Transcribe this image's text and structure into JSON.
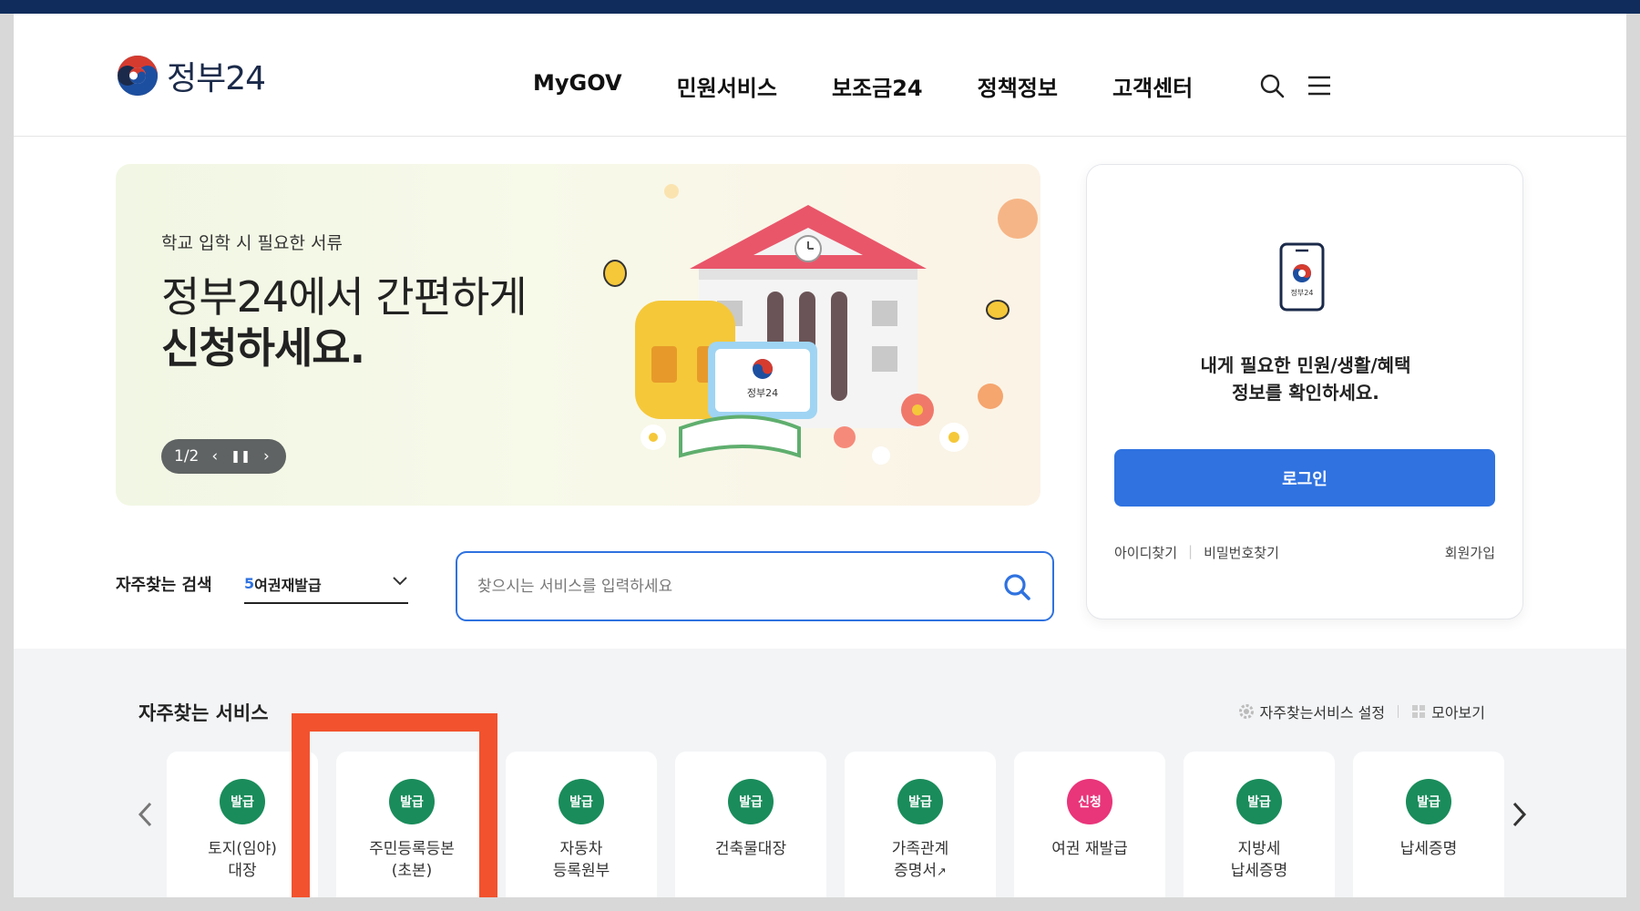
{
  "header": {
    "logo_text": "정부24",
    "nav": [
      "MyGOV",
      "민원서비스",
      "보조금24",
      "정책정보",
      "고객센터"
    ]
  },
  "banner": {
    "subtitle": "학교 입학 시 필요한 서류",
    "title_line1": "정부24에서 간편하게",
    "title_line2": "신청하세요.",
    "pager": "1/2",
    "art_label": "정부24"
  },
  "login": {
    "app_label": "정부24",
    "message_line1": "내게 필요한 민원/생활/혜택",
    "message_line2": "정보를 확인하세요.",
    "button": "로그인",
    "find_id": "아이디찾기",
    "find_pw": "비밀번호찾기",
    "join": "회원가입"
  },
  "search": {
    "freq_label": "자주찾는 검색",
    "rank": "5",
    "keyword": "여권재발급",
    "placeholder": "찾으시는 서비스를 입력하세요"
  },
  "services": {
    "title": "자주찾는 서비스",
    "settings": "자주찾는서비스 설정",
    "view_all": "모아보기",
    "items": [
      {
        "badge": "발급",
        "name1": "토지(임야)",
        "name2": "대장"
      },
      {
        "badge": "발급",
        "name1": "주민등록등본",
        "name2": "(초본)"
      },
      {
        "badge": "발급",
        "name1": "자동차",
        "name2": "등록원부"
      },
      {
        "badge": "발급",
        "name1": "건축물대장",
        "name2": ""
      },
      {
        "badge": "발급",
        "name1": "가족관계",
        "name2": "증명서"
      },
      {
        "badge": "신청",
        "name1": "여권 재발급",
        "name2": ""
      },
      {
        "badge": "발급",
        "name1": "지방세",
        "name2": "납세증명"
      },
      {
        "badge": "발급",
        "name1": "납세증명",
        "name2": ""
      }
    ]
  },
  "colors": {
    "primary": "#2f72e0",
    "badge_green": "#1a8c5b",
    "badge_pink": "#e9357a",
    "highlight": "#f2522e"
  }
}
